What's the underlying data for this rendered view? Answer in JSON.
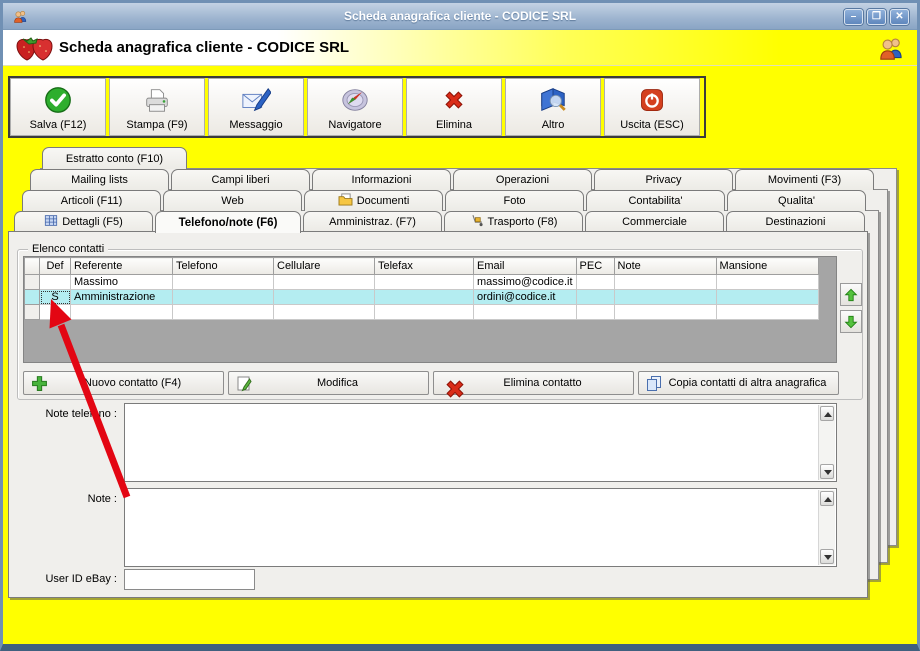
{
  "window": {
    "title": "Scheda anagrafica cliente - CODICE SRL",
    "controls": [
      {
        "name": "minimize",
        "glyph": "–"
      },
      {
        "name": "maximize",
        "glyph": "❐"
      },
      {
        "name": "close",
        "glyph": "✕"
      }
    ]
  },
  "header": {
    "title": "Scheda anagrafica cliente - CODICE SRL"
  },
  "toolbar": {
    "buttons": [
      {
        "label": "Salva (F12)",
        "icon": "check-circle"
      },
      {
        "label": "Stampa (F9)",
        "icon": "printer"
      },
      {
        "label": "Messaggio",
        "icon": "envelope-pen"
      },
      {
        "label": "Navigatore",
        "icon": "compass"
      },
      {
        "label": "Elimina",
        "icon": "red-x"
      },
      {
        "label": "Altro",
        "icon": "book-magnifier"
      },
      {
        "label": "Uscita (ESC)",
        "icon": "power"
      }
    ]
  },
  "tabs": {
    "rows": [
      [
        {
          "label": "Estratto conto (F10)"
        }
      ],
      [
        {
          "label": "Mailing lists"
        },
        {
          "label": "Campi liberi"
        },
        {
          "label": "Informazioni"
        },
        {
          "label": "Operazioni"
        },
        {
          "label": "Privacy"
        },
        {
          "label": "Movimenti (F3)"
        }
      ],
      [
        {
          "label": "Articoli (F11)"
        },
        {
          "label": "Web"
        },
        {
          "label": "Documenti",
          "icon": "folder"
        },
        {
          "label": "Foto"
        },
        {
          "label": "Contabilita'"
        },
        {
          "label": "Qualita'"
        }
      ],
      [
        {
          "label": "Dettagli (F5)",
          "icon": "table"
        },
        {
          "label": "Telefono/note (F6)",
          "active": true
        },
        {
          "label": "Amministraz. (F7)"
        },
        {
          "label": "Trasporto (F8)",
          "icon": "trolley"
        },
        {
          "label": "Commerciale"
        },
        {
          "label": "Destinazioni"
        }
      ]
    ],
    "active": "Telefono/note (F6)"
  },
  "contacts": {
    "group_label": "Elenco contatti",
    "columns": [
      "Def",
      "Referente",
      "Telefono",
      "Cellulare",
      "Telefax",
      "Email",
      "PEC",
      "Note",
      "Mansione"
    ],
    "rows": [
      {
        "def": "",
        "referente": "Massimo",
        "telefono": "",
        "cellulare": "",
        "telefax": "",
        "email": "massimo@codice.it",
        "pec": "",
        "note": "",
        "mansione": "",
        "selected": false
      },
      {
        "def": "S",
        "referente": "Amministrazione",
        "telefono": "",
        "cellulare": "",
        "telefax": "",
        "email": "ordini@codice.it",
        "pec": "",
        "note": "",
        "mansione": "",
        "selected": true
      },
      {
        "def": "",
        "referente": "",
        "telefono": "",
        "cellulare": "",
        "telefax": "",
        "email": "",
        "pec": "",
        "note": "",
        "mansione": "",
        "selected": false
      }
    ],
    "actions": [
      {
        "label": "Nuovo contatto (F4)",
        "icon": "plus"
      },
      {
        "label": "Modifica",
        "icon": "edit"
      },
      {
        "label": "Elimina contatto",
        "icon": "red-x"
      },
      {
        "label": "Copia contatti di altra anagrafica",
        "icon": "copy"
      }
    ]
  },
  "fields": {
    "note_telefono": {
      "label": "Note telefono :",
      "value": ""
    },
    "note": {
      "label": "Note :",
      "value": ""
    },
    "ebay": {
      "label": "User ID eBay :",
      "value": ""
    }
  },
  "colors": {
    "background_yellow": "#ffff00",
    "selected_row": "#b4edf1",
    "titlebar_blue": "#9db4cf",
    "arrow_red": "#e30613",
    "green_arrow": "#44b52e"
  }
}
